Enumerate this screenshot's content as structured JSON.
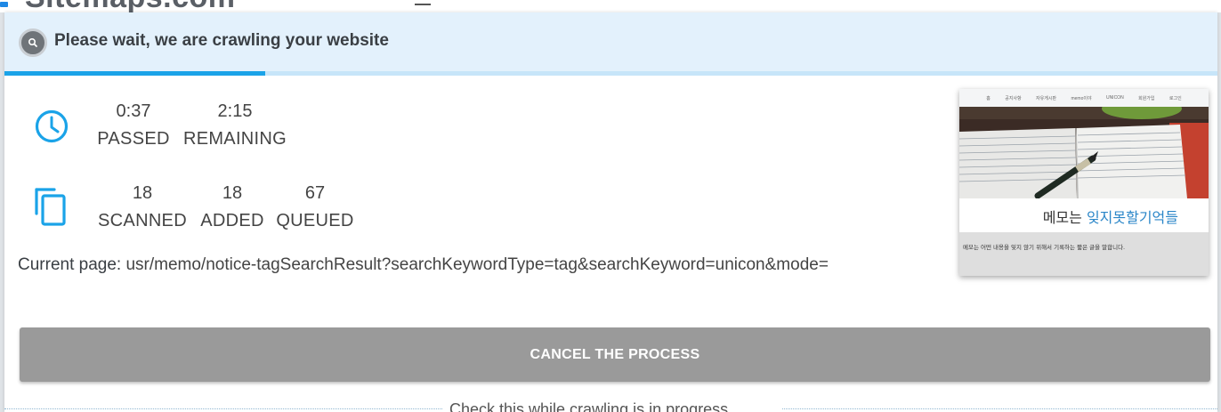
{
  "background": {
    "logo_text": "Sitemaps.com"
  },
  "modal": {
    "title": "Please wait, we are crawling your website",
    "progress_percent": 21.5,
    "stats": {
      "passed": {
        "value": "0:37",
        "label": "PASSED"
      },
      "remaining": {
        "value": "2:15",
        "label": "REMAINING"
      },
      "scanned": {
        "value": "18",
        "label": "SCANNED"
      },
      "added": {
        "value": "18",
        "label": "ADDED"
      },
      "queued": {
        "value": "67",
        "label": "QUEUED"
      }
    },
    "current_page": {
      "label": "Current page:",
      "url": "usr/memo/notice-tagSearchResult?searchKeywordType=tag&searchKeyword=unicon&mode="
    },
    "preview": {
      "nav_items": [
        "홈",
        "공지사항",
        "자유게시판",
        "memo이야",
        "UNICON",
        "회원가입",
        "로그인"
      ],
      "caption_prefix": "메모는 ",
      "caption_highlight": "잊지못할기억들",
      "description": "메모는 어떤 내용을 잊지 않기 위해서 기록하는 짧은 글을 말합니다."
    },
    "cancel_button": "CANCEL THE PROCESS",
    "hint": "Check this while crawling is in progress"
  },
  "colors": {
    "accent": "#1aa3e8",
    "header_bg": "#e3f1fc",
    "button_bg": "#9a9a9a"
  },
  "icons": {
    "header": "search-icon",
    "time": "clock-icon",
    "pages": "copy-pages-icon"
  }
}
